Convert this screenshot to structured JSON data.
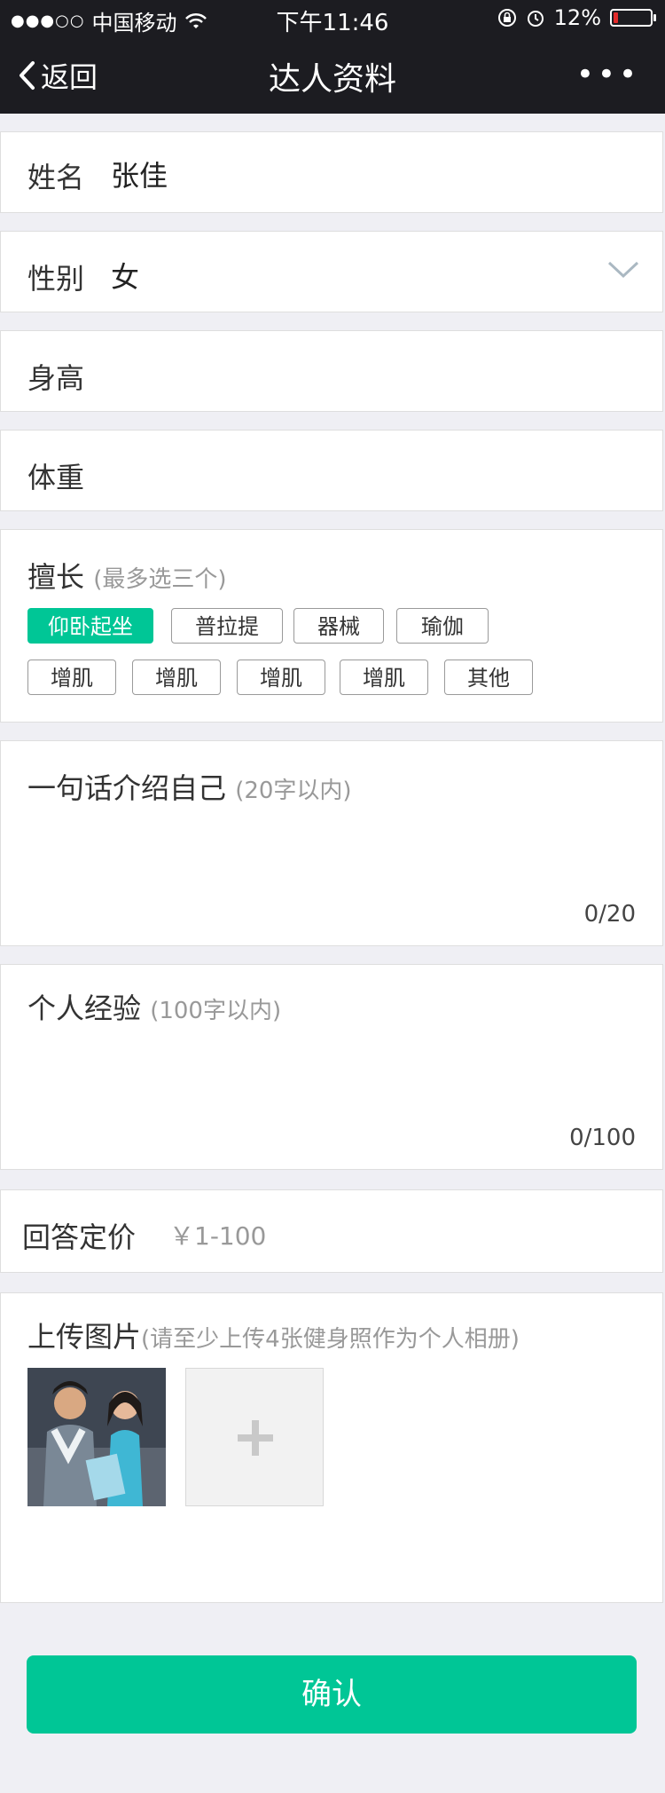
{
  "status_bar": {
    "carrier": "中国移动",
    "time": "下午11:46",
    "battery": "12%",
    "battery_level": 0.12
  },
  "nav": {
    "back_label": "返回",
    "title": "达人资料",
    "more": "•••"
  },
  "form": {
    "name": {
      "label": "姓名",
      "value": "张佳"
    },
    "gender": {
      "label": "性别",
      "value": "女"
    },
    "height": {
      "label": "身高",
      "value": ""
    },
    "weight": {
      "label": "体重",
      "value": ""
    },
    "specialty": {
      "label": "擅长",
      "hint": "(最多选三个)",
      "tags": [
        "仰卧起坐",
        "普拉提",
        "器械",
        "瑜伽",
        "增肌",
        "增肌",
        "增肌",
        "增肌",
        "其他"
      ],
      "selected": [
        "仰卧起坐"
      ]
    },
    "intro": {
      "label": "一句话介绍自己",
      "hint": "(20字以内)",
      "counter": "0/20"
    },
    "experience": {
      "label": "个人经验",
      "hint": "(100字以内)",
      "counter": "0/100"
    },
    "price": {
      "label": "回答定价",
      "placeholder": "￥1-100"
    },
    "upload": {
      "label": "上传图片",
      "hint": "(请至少上传4张健身照作为个人相册)"
    }
  },
  "confirm_label": "确认",
  "colors": {
    "accent": "#00c696",
    "bar": "#1c1c21",
    "background": "#efeff4"
  }
}
